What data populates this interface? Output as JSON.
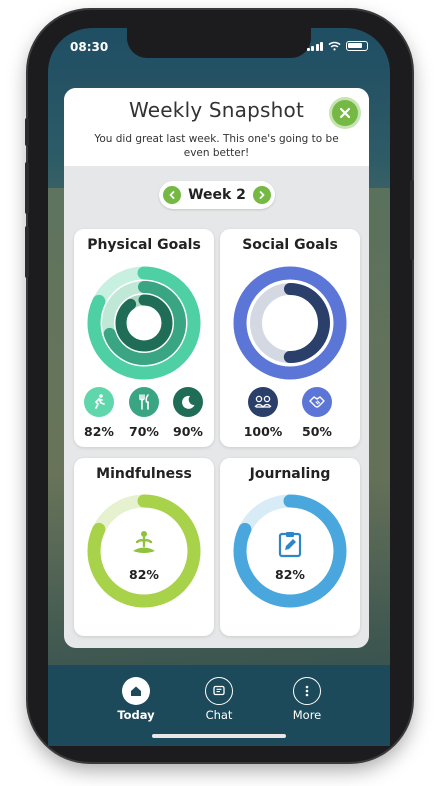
{
  "status": {
    "time": "08:30"
  },
  "modal": {
    "title": "Weekly Snapshot",
    "subtitle": "You did great last week. This one's going to be even better!",
    "week_label": "Week 2"
  },
  "cards": {
    "physical": {
      "title": "Physical Goals",
      "activity_pct": "82%",
      "nutrition_pct": "70%",
      "sleep_pct": "90%",
      "activity_value": 0.82,
      "nutrition_value": 0.7,
      "sleep_value": 0.9
    },
    "social": {
      "title": "Social Goals",
      "group_pct": "100%",
      "partner_pct": "50%",
      "group_value": 1.0,
      "partner_value": 0.5
    },
    "mindfulness": {
      "title": "Mindfulness",
      "pct": "82%",
      "value": 0.82
    },
    "journaling": {
      "title": "Journaling",
      "pct": "82%",
      "value": 0.82
    }
  },
  "nav": {
    "today": "Today",
    "chat": "Chat",
    "more": "More"
  },
  "colors": {
    "accent_green": "#75b843",
    "physical_teal": "#4fcfa4",
    "physical_dark": "#1f6d57",
    "social_blue": "#5b76d6",
    "social_navy": "#2b3f6b",
    "mind_green": "#a7d24a",
    "journal_blue": "#4aa7de",
    "nav_bg": "#1d4a5a"
  }
}
